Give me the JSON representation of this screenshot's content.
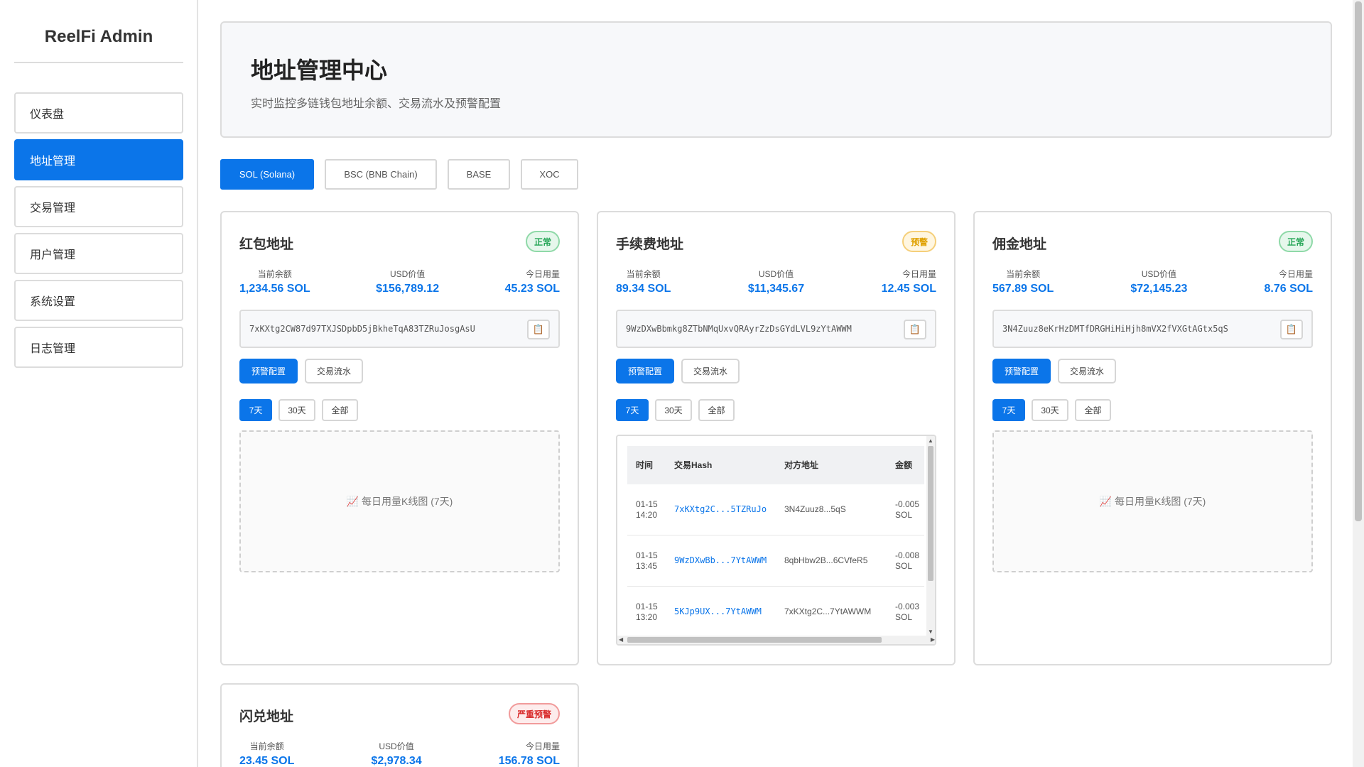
{
  "app": {
    "brand": "ReelFi Admin"
  },
  "sidebar": {
    "items": [
      {
        "label": "仪表盘"
      },
      {
        "label": "地址管理"
      },
      {
        "label": "交易管理"
      },
      {
        "label": "用户管理"
      },
      {
        "label": "系统设置"
      },
      {
        "label": "日志管理"
      }
    ]
  },
  "header": {
    "title": "地址管理中心",
    "subtitle": "实时监控多链钱包地址余额、交易流水及预警配置"
  },
  "chains": [
    {
      "label": "SOL (Solana)"
    },
    {
      "label": "BSC (BNB Chain)"
    },
    {
      "label": "BASE"
    },
    {
      "label": "XOC"
    }
  ],
  "labels": {
    "balance": "当前余额",
    "usd": "USD价值",
    "today": "今日用量",
    "alert_config": "预警配置",
    "tx_flow": "交易流水",
    "range_7d": "7天",
    "range_30d": "30天",
    "range_all": "全部",
    "chart_placeholder": "📈 每日用量K线图 (7天)",
    "copy_icon": "📋"
  },
  "cards": [
    {
      "title": "红包地址",
      "status": "正常",
      "status_color": "#22a454",
      "balance": "1,234.56 SOL",
      "usd": "$156,789.12",
      "today": "45.23 SOL",
      "address": "7xKXtg2CW87d97TXJSDpbD5jBkheTqA83TZRuJosgAsU"
    },
    {
      "title": "手续费地址",
      "status": "预警",
      "status_color": "#e0a100",
      "balance": "89.34 SOL",
      "usd": "$11,345.67",
      "today": "12.45 SOL",
      "address": "9WzDXwBbmkg8ZTbNMqUxvQRAyrZzDsGYdLVL9zYtAWWM"
    },
    {
      "title": "佣金地址",
      "status": "正常",
      "status_color": "#22a454",
      "balance": "567.89 SOL",
      "usd": "$72,145.23",
      "today": "8.76 SOL",
      "address": "3N4Zuuz8eKrHzDMTfDRGHiHiHjh8mVX2fVXGtAGtx5qS"
    },
    {
      "title": "闪兑地址",
      "status": "严重预警",
      "status_color": "#d92c2c",
      "balance": "23.45 SOL",
      "usd": "$2,978.34",
      "today": "156.78 SOL"
    }
  ],
  "transactions": {
    "columns": [
      "时间",
      "交易Hash",
      "对方地址",
      "金额"
    ],
    "rows": [
      {
        "time": "01-15 14:20",
        "hash": "7xKXtg2C...5TZRuJo",
        "counterparty": "3N4Zuuz8...5qS",
        "amount": "-0.005 SOL"
      },
      {
        "time": "01-15 13:45",
        "hash": "9WzDXwBb...7YtAWWM",
        "counterparty": "8qbHbw2B...6CVfeR5",
        "amount": "-0.008 SOL"
      },
      {
        "time": "01-15 13:20",
        "hash": "5KJp9UX...7YtAWWM",
        "counterparty": "7xKXtg2C...7YtAWWM",
        "amount": "-0.003 SOL"
      }
    ]
  },
  "colors": {
    "accent": "#0b75e9"
  }
}
